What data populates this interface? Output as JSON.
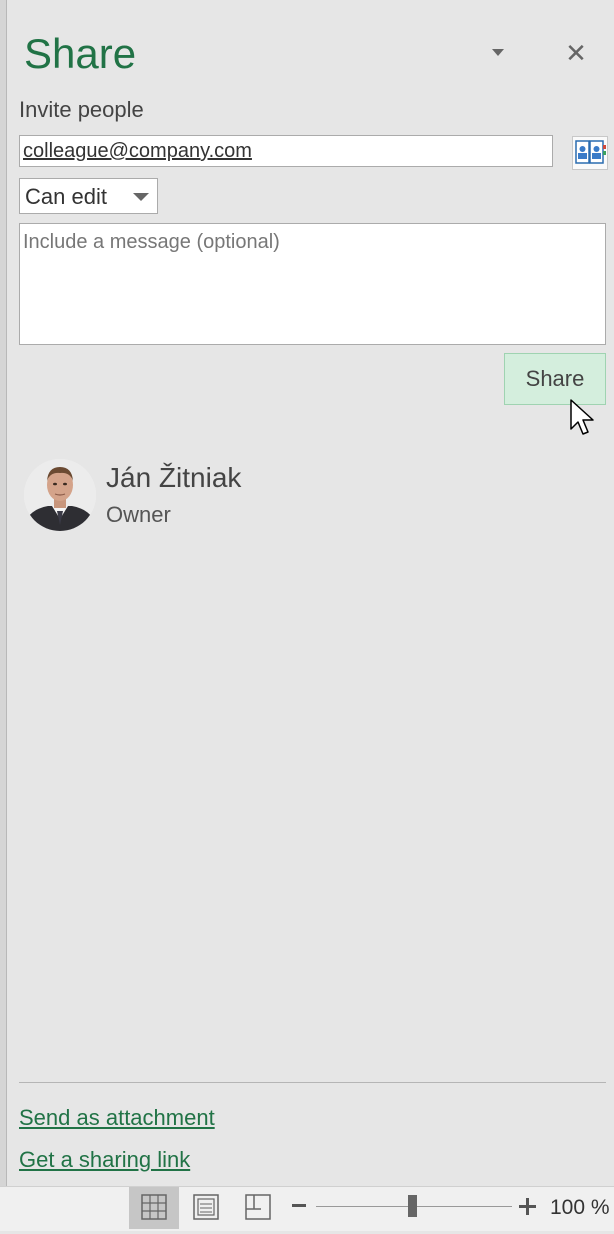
{
  "pane": {
    "title": "Share",
    "menu_icon": "chevron-down-icon",
    "close_glyph": "✕"
  },
  "invite": {
    "label": "Invite people",
    "email_value": "colleague@company.com",
    "address_book_icon": "address-book-icon",
    "permission": "Can edit",
    "message_placeholder": "Include a message (optional)",
    "share_button": "Share"
  },
  "people": [
    {
      "name": "Ján Žitniak",
      "role": "Owner"
    }
  ],
  "footer_links": {
    "send_attachment": "Send as attachment",
    "sharing_link": "Get a sharing link"
  },
  "statusbar": {
    "views": [
      "normal-view-icon",
      "page-layout-view-icon",
      "page-break-preview-icon"
    ],
    "active_view": "normal-view-icon",
    "zoom_level": "100 %",
    "zoom_percent": 100
  },
  "colors": {
    "accent": "#217346",
    "share_button_bg": "#d4eedd",
    "pane_bg": "#e6e6e6"
  }
}
